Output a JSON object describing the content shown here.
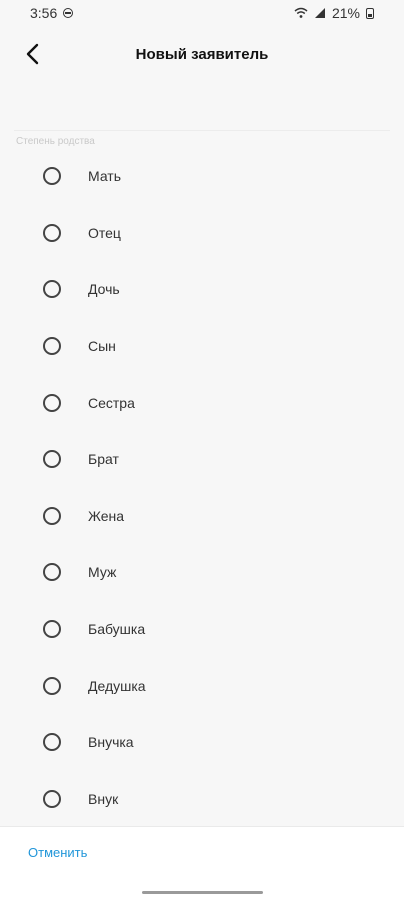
{
  "status_bar": {
    "time": "3:56",
    "battery": "21%",
    "icons": [
      "do-not-disturb-icon",
      "wifi-icon",
      "signal-icon",
      "battery-icon"
    ]
  },
  "app_bar": {
    "title": "Новый заявитель",
    "back_icon": "chevron-left-icon"
  },
  "section_label": "Степень родства",
  "options": [
    {
      "label": "Мать",
      "selected": false
    },
    {
      "label": "Отец",
      "selected": false
    },
    {
      "label": "Дочь",
      "selected": false
    },
    {
      "label": "Сын",
      "selected": false
    },
    {
      "label": "Сестра",
      "selected": false
    },
    {
      "label": "Брат",
      "selected": false
    },
    {
      "label": "Жена",
      "selected": false
    },
    {
      "label": "Муж",
      "selected": false
    },
    {
      "label": "Бабушка",
      "selected": false
    },
    {
      "label": "Дедушка",
      "selected": false
    },
    {
      "label": "Внучка",
      "selected": false
    },
    {
      "label": "Внук",
      "selected": false
    }
  ],
  "footer": {
    "cancel_label": "Отменить"
  },
  "colors": {
    "accent": "#2196d9",
    "background": "#f7f7f7",
    "text": "#333333"
  }
}
